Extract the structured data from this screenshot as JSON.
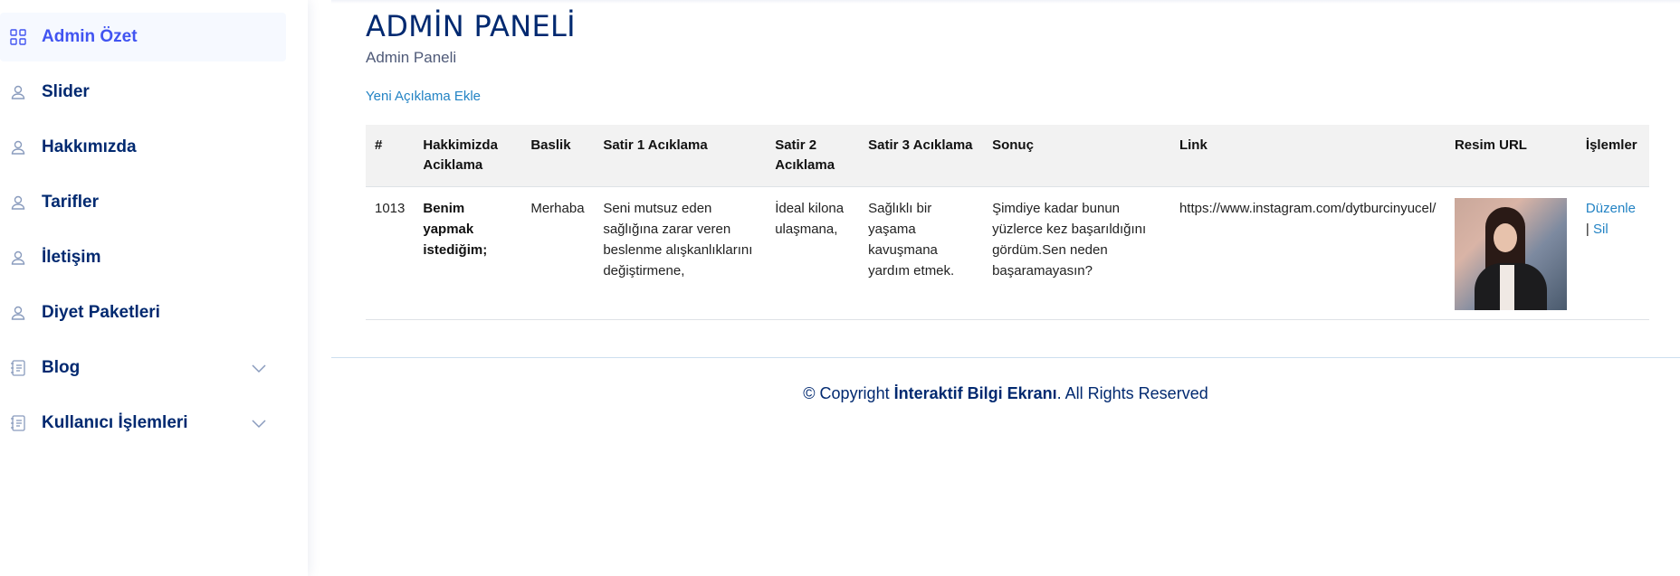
{
  "sidebar": {
    "items": [
      {
        "label": "Admin Özet",
        "icon": "grid-icon",
        "active": true
      },
      {
        "label": "Slider",
        "icon": "person-icon"
      },
      {
        "label": "Hakkımızda",
        "icon": "person-icon"
      },
      {
        "label": "Tarifler",
        "icon": "person-icon"
      },
      {
        "label": "İletişim",
        "icon": "person-icon"
      },
      {
        "label": "Diyet Paketleri",
        "icon": "person-icon"
      },
      {
        "label": "Blog",
        "icon": "journal-icon",
        "expandable": true
      },
      {
        "label": "Kullanıcı İşlemleri",
        "icon": "journal-icon",
        "expandable": true
      }
    ]
  },
  "header": {
    "title": "ADMİN PANELİ",
    "subtitle": "Admin Paneli",
    "add_link": "Yeni Açıklama Ekle"
  },
  "table": {
    "headers": [
      "#",
      "Hakkimizda Aciklama",
      "Baslik",
      "Satir 1 Acıklama",
      "Satir 2 Acıklama",
      "Satir 3 Acıklama",
      "Sonuç",
      "Link",
      "Resim URL",
      "İşlemler"
    ],
    "rows": [
      {
        "id": "1013",
        "aciklama": "Benim yapmak istediğim;",
        "baslik": "Merhaba",
        "satir1": "Seni mutsuz eden sağlığına zarar veren beslenme alışkanlıklarını değiştirmene,",
        "satir2": "İdeal kilona ulaşmana,",
        "satir3": "Sağlıklı bir yaşama kavuşmana yardım etmek.",
        "sonuc": "Şimdiye kadar bunun yüzlerce kez başarıldığını gördüm.Sen neden başaramayasın?",
        "link": "https://www.instagram.com/dytburcinyucel/",
        "image_alt": "profile-photo",
        "edit_label": "Düzenle",
        "separator": "|",
        "delete_label": "Sil"
      }
    ]
  },
  "footer": {
    "prefix": "© Copyright ",
    "brand": "İnteraktif Bilgi Ekranı",
    "suffix": ". All Rights Reserved"
  },
  "colors": {
    "nav_text": "#012970",
    "active_text": "#4154f1",
    "active_bg": "#f6f9ff",
    "link": "#2383c4"
  }
}
